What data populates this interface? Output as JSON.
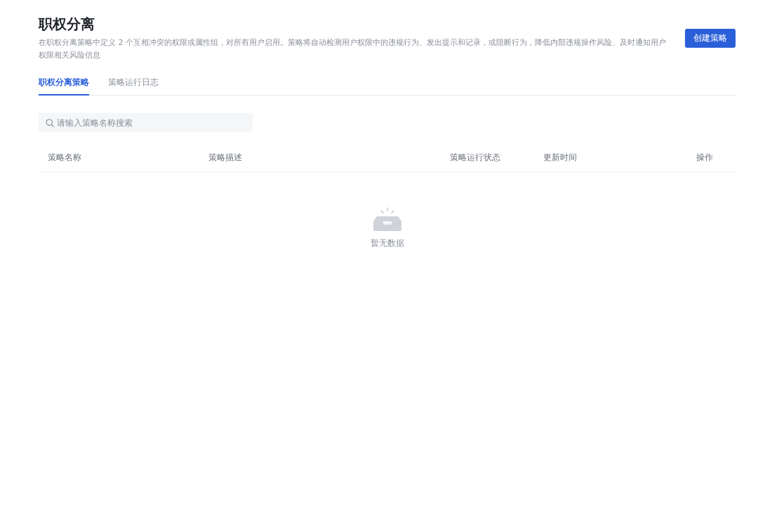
{
  "header": {
    "title": "职权分离",
    "description": "在职权分离策略中定义 2 个互相冲突的权限或属性组，对所有用户启用。策略将自动检测用户权限中的违规行为、发出提示和记录，或阻断行为，降低内部违规操作风险、及时通知用户权限相关风险信息",
    "button": "创建策略"
  },
  "tabs": [
    {
      "label": "职权分离策略",
      "selected": true
    },
    {
      "label": "策略运行日志",
      "selected": false
    }
  ],
  "search": {
    "placeholder": "请输入策略名称搜索"
  },
  "table": {
    "columns": [
      "策略名称",
      "策略描述",
      "策略运行状态",
      "更新时间",
      "操作"
    ],
    "empty_text": "暂无数据"
  }
}
